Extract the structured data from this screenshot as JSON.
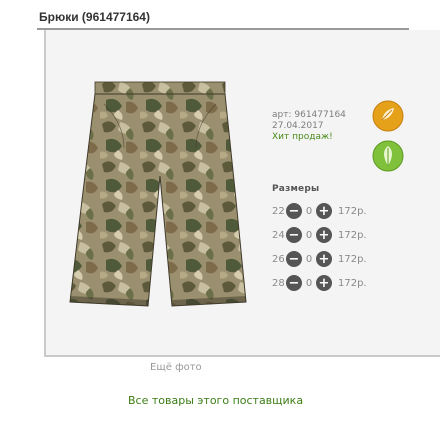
{
  "header": {
    "title": "Брюки (961477164)"
  },
  "product": {
    "article": "арт: 961477164",
    "date": "27.04.2017",
    "hit": "Хит продаж!"
  },
  "sizes": {
    "title": "Размеры",
    "rows": [
      {
        "size": "22",
        "qty": "0",
        "price": "172р."
      },
      {
        "size": "24",
        "qty": "0",
        "price": "172р."
      },
      {
        "size": "26",
        "qty": "0",
        "price": "172р."
      },
      {
        "size": "28",
        "qty": "0",
        "price": "172р."
      }
    ]
  },
  "links": {
    "more_photo": "Ещё фото",
    "all_goods": "Все товары этого поставщика"
  },
  "icons": {
    "badge1": "leaf-orange-icon",
    "badge2": "leaf-green-icon",
    "minus": "minus-circle-icon",
    "plus": "plus-circle-icon"
  },
  "colors": {
    "accent_green": "#3c7d16",
    "badge_orange": "#e6a11b",
    "badge_green": "#7fc13b"
  }
}
